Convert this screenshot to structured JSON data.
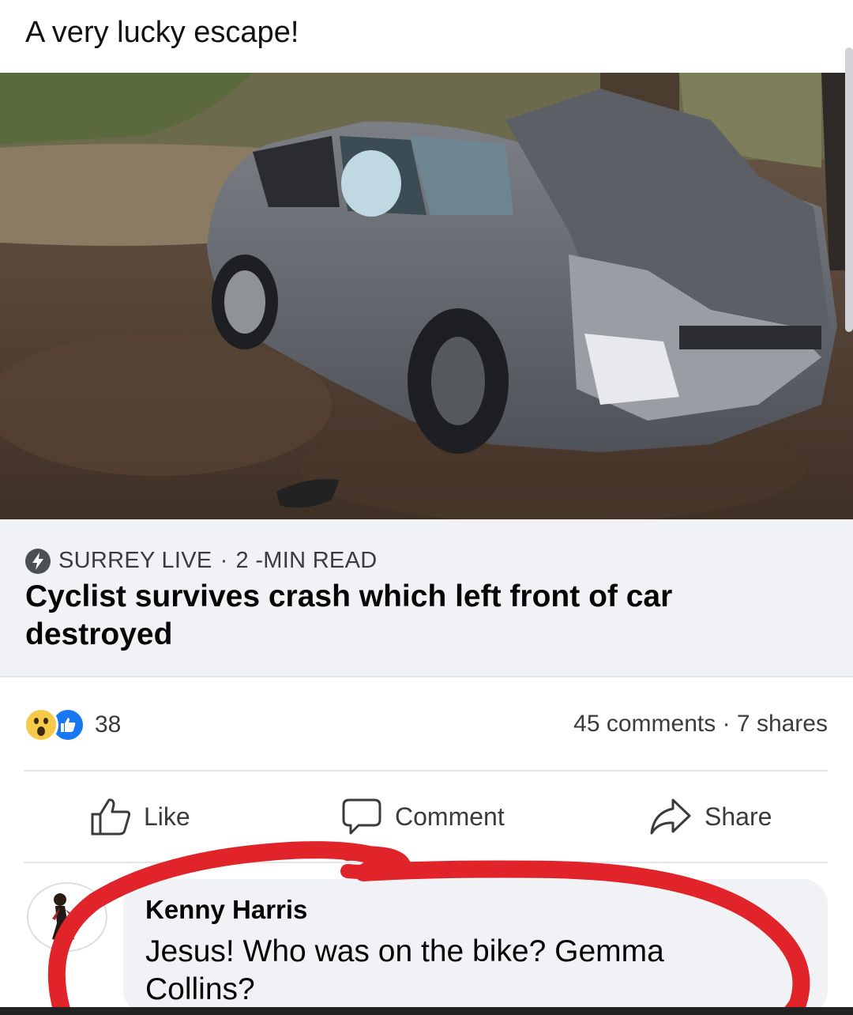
{
  "post": {
    "text": "A very lucky escape!"
  },
  "link_preview": {
    "source": "SURREY LIVE",
    "separator": "·",
    "read_time": "2 -MIN READ",
    "headline": "Cyclist survives crash which left front of car destroyed"
  },
  "stats": {
    "reaction_count": "38",
    "comments": "45 comments",
    "separator": "·",
    "shares": "7 shares"
  },
  "actions": {
    "like": "Like",
    "comment": "Comment",
    "share": "Share"
  },
  "comment": {
    "author": "Kenny Harris",
    "text": "Jesus! Who was on the bike? Gemma Collins?"
  },
  "colors": {
    "like_blue": "#1877f2",
    "wow_yellow": "#f7c948",
    "annotation_red": "#e0242a",
    "card_grey": "#f0f2f5"
  },
  "icons": [
    "bolt-icon",
    "wow-reaction-icon",
    "like-reaction-icon",
    "thumbs-up-icon",
    "speech-bubble-icon",
    "share-arrow-icon"
  ]
}
